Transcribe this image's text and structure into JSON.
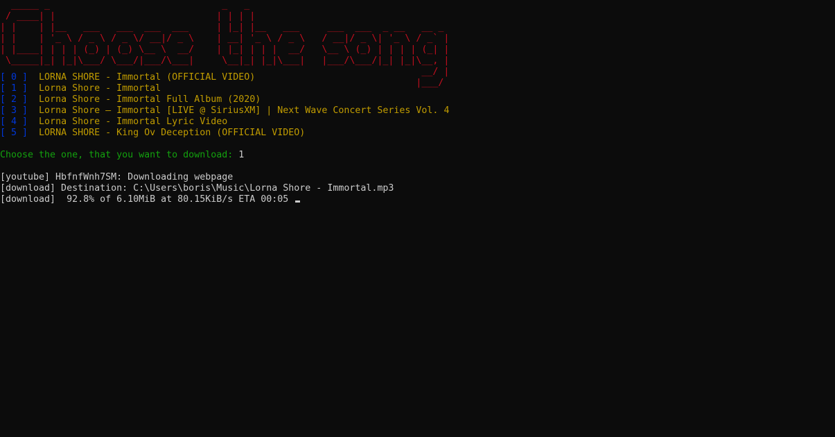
{
  "banner": {
    "text": "  _____ _                               _   _                                  \n / ____| |                             | | | |                                 \n| |    | |__   ___   ___  ___  ___     | |_| |__   ___     ___  ___  _ __   __ _ \n| |    | '_ \\ / _ \\ / _ \\/ __|/ _ \\    | __| '_ \\ / _ \\   / __|/ _ \\| '_ \\ / _` |\n| |____| | | | (_) | (_) \\__ \\  __/    | |_| | | |  __/   \\__ \\ (_) | | | | (_| |\n \\_____|_| |_|\\___/ \\___/|___/\\___|     \\__|_| |_|\\___|   |___/\\___/|_| |_|\\__, |\n                                                                            __/ |\n                                                                           |___/ ",
    "color": "#c50f1f"
  },
  "songs": [
    {
      "index": "[ 0 ]",
      "title": "LORNA SHORE - Immortal (OFFICIAL VIDEO)"
    },
    {
      "index": "[ 1 ]",
      "title": "Lorna Shore - Immortal"
    },
    {
      "index": "[ 2 ]",
      "title": "Lorna Shore - Immortal Full Album (2020)"
    },
    {
      "index": "[ 3 ]",
      "title": "Lorna Shore — Immortal [LIVE @ SiriusXM] | Next Wave Concert Series Vol. 4"
    },
    {
      "index": "[ 4 ]",
      "title": "Lorna Shore - Immortal Lyric Video"
    },
    {
      "index": "[ 5 ]",
      "title": "LORNA SHORE - King Ov Deception (OFFICIAL VIDEO)"
    }
  ],
  "prompt": {
    "question": "Choose the one, that you want to download: ",
    "answer": "1"
  },
  "log": [
    "[youtube] HbfnfWnh7SM: Downloading webpage",
    "[download] Destination: C:\\Users\\boris\\Music\\Lorna Shore - Immortal.mp3",
    "[download]  92.8% of 6.10MiB at 80.15KiB/s ETA 00:05"
  ],
  "colors": {
    "background": "#0c0c0c",
    "index": "#0037da",
    "song": "#c19c00",
    "prompt": "#13a10e",
    "text": "#cccccc"
  }
}
